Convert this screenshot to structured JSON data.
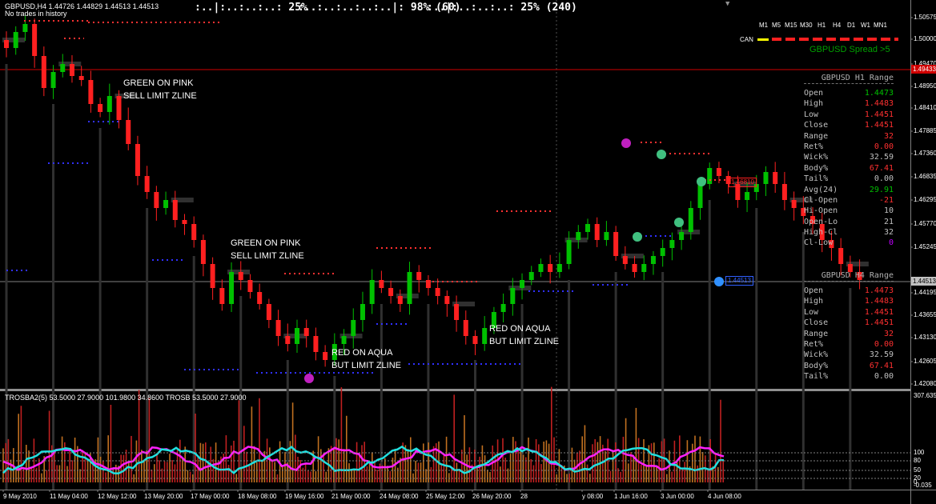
{
  "chart_header": {
    "symbol_line": "GBPUSD,H4  1.44726 1.44829 1.44513 1.44513",
    "no_trades": "No trades in history"
  },
  "status": {
    "gauge1": ":..|:..:..:..:  25%",
    "gauge2": ":..:..:..:..:..|:  98%  (60)",
    "gauge3": ":..|:..:..:..:  25%  (240)"
  },
  "timeframes": [
    "M1",
    "M5",
    "M15",
    "M30",
    "H1",
    "H4",
    "D1",
    "W1",
    "MN1"
  ],
  "can_label": "CAN",
  "spread_label": "GBPUSD Spread  >5",
  "annotations": [
    {
      "line1": "GREEN ON PINK",
      "line2": "SELL LIMIT ZLINE"
    },
    {
      "line1": "GREEN ON PINK",
      "line2": "SELL LIMIT ZLINE"
    },
    {
      "line1": "RED ON AQUA",
      "line2": "BUT LIMIT ZLINE"
    },
    {
      "line1": "RED ON AQUA",
      "line2": "BUT LIMIT ZLINE"
    }
  ],
  "price_axis": [
    "1.50575",
    "1.50000",
    "1.49470",
    "1.48950",
    "1.48410",
    "1.47885",
    "1.47360",
    "1.46835",
    "1.46295",
    "1.45770",
    "1.45245",
    "1.44513",
    "1.44195",
    "1.43655",
    "1.43130",
    "1.42605",
    "1.42080"
  ],
  "price_tags": {
    "red_line": "1.49433",
    "current": "1.44513",
    "box1": "1.46810",
    "box2": "1.44513"
  },
  "h1_panel": {
    "title": "GBPUSD H1 Range",
    "rows": [
      {
        "label": "Open",
        "value": "1.4473",
        "color": "#00c000"
      },
      {
        "label": "High",
        "value": "1.4483",
        "color": "#ff3030"
      },
      {
        "label": "Low",
        "value": "1.4451",
        "color": "#ff3030"
      },
      {
        "label": "Close",
        "value": "1.4451",
        "color": "#ff3030"
      },
      {
        "label": "Range",
        "value": "32",
        "color": "#ff3030"
      },
      {
        "label": "Ret%",
        "value": "0.00",
        "color": "#ff3030"
      },
      {
        "label": "Wick%",
        "value": "32.59",
        "color": "#c0c0c0"
      },
      {
        "label": "Body%",
        "value": "67.41",
        "color": "#ff3030"
      },
      {
        "label": "Tail%",
        "value": "0.00",
        "color": "#c0c0c0"
      },
      {
        "label": "Avg(24)",
        "value": "29.91",
        "color": "#00c000"
      },
      {
        "label": "Cl-Open",
        "value": "-21",
        "color": "#ff3030"
      },
      {
        "label": "Hi-Open",
        "value": "10",
        "color": "#c0c0c0"
      },
      {
        "label": "Open-Lo",
        "value": "21",
        "color": "#c0c0c0"
      },
      {
        "label": "High-Cl",
        "value": "32",
        "color": "#c0c0c0"
      },
      {
        "label": "Cl-Low",
        "value": "0",
        "color": "#c000ff"
      }
    ]
  },
  "h4_panel": {
    "title": "GBPUSD H4 Range",
    "rows": [
      {
        "label": "Open",
        "value": "1.4473",
        "color": "#ff3030"
      },
      {
        "label": "High",
        "value": "1.4483",
        "color": "#ff3030"
      },
      {
        "label": "Low",
        "value": "1.4451",
        "color": "#ff3030"
      },
      {
        "label": "Close",
        "value": "1.4451",
        "color": "#ff3030"
      },
      {
        "label": "Range",
        "value": "32",
        "color": "#ff3030"
      },
      {
        "label": "Ret%",
        "value": "0.00",
        "color": "#ff3030"
      },
      {
        "label": "Wick%",
        "value": "32.59",
        "color": "#c0c0c0"
      },
      {
        "label": "Body%",
        "value": "67.41",
        "color": "#ff3030"
      },
      {
        "label": "Tail%",
        "value": "0.00",
        "color": "#c0c0c0"
      }
    ]
  },
  "indicator": {
    "label": "TROSBA2(5) 53.5000 27.9000 101.9800 34.8600  TROSB 53.5000 27.9000",
    "axis": [
      "307.635",
      "100",
      "80",
      "50",
      "20",
      "0",
      "-0.035"
    ]
  },
  "time_axis": [
    "9 May 2010",
    "11 May 04:00",
    "12 May 12:00",
    "13 May 20:00",
    "17 May 00:00",
    "18 May 08:00",
    "19 May 16:00",
    "21 May 00:00",
    "24 May 08:00",
    "25 May 12:00",
    "26 May 20:00",
    "28",
    "y 08:00",
    "1 Jun 16:00",
    "3 Jun 00:00",
    "4 Jun 08:00"
  ],
  "colors": {
    "bull": "#00c000",
    "bear": "#ff2020",
    "pink": "#ff20ff",
    "aqua": "#20e0e0",
    "blue_dash": "#3030ff",
    "red_dash": "#ff3030",
    "grid": "#404040"
  }
}
